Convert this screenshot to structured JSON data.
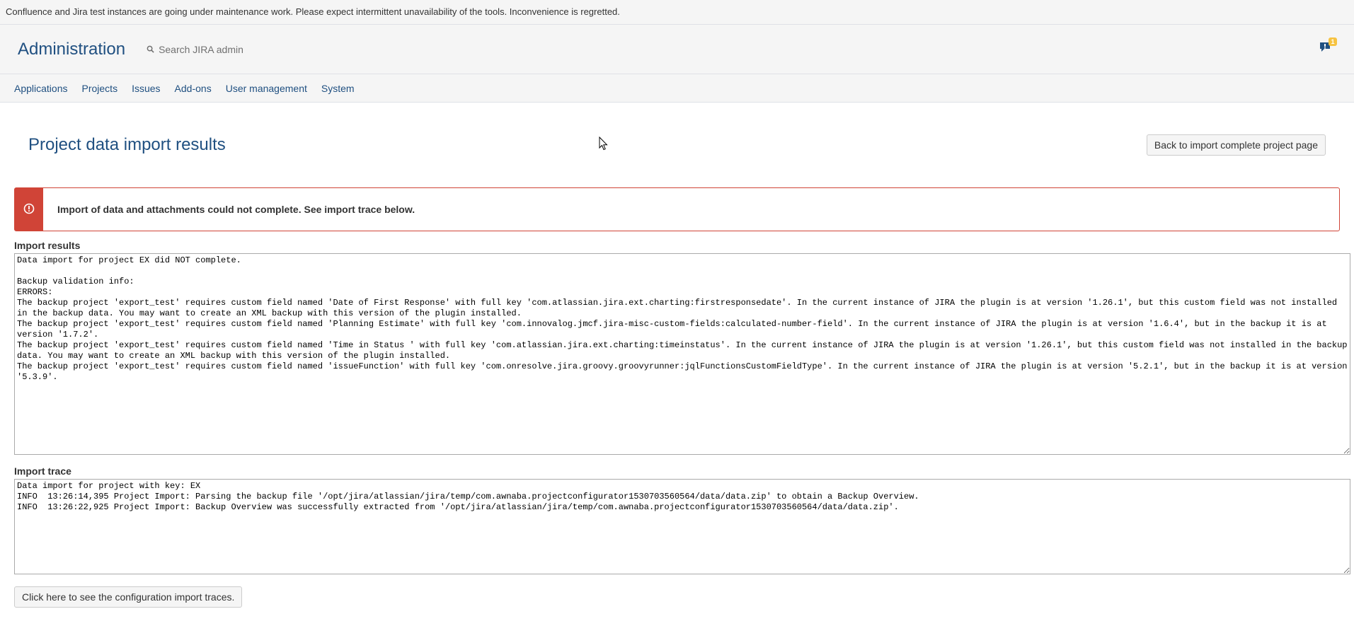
{
  "banner": {
    "text": "Confluence and Jira test instances are going under maintenance work. Please expect intermittent unavailability of the tools. Inconvenience is regretted."
  },
  "header": {
    "title": "Administration",
    "search_placeholder": "Search JIRA admin",
    "notification_count": "1"
  },
  "nav": {
    "items": [
      "Applications",
      "Projects",
      "Issues",
      "Add-ons",
      "User management",
      "System"
    ]
  },
  "page": {
    "title": "Project data import results",
    "back_button": "Back to import complete project page",
    "error_message": "Import of data and attachments could not complete. See import trace below.",
    "results_label": "Import results",
    "results_text": "Data import for project EX did NOT complete.\n\nBackup validation info:\nERRORS:\nThe backup project 'export_test' requires custom field named 'Date of First Response' with full key 'com.atlassian.jira.ext.charting:firstresponsedate'. In the current instance of JIRA the plugin is at version '1.26.1', but this custom field was not installed in the backup data. You may want to create an XML backup with this version of the plugin installed.\nThe backup project 'export_test' requires custom field named 'Planning Estimate' with full key 'com.innovalog.jmcf.jira-misc-custom-fields:calculated-number-field'. In the current instance of JIRA the plugin is at version '1.6.4', but in the backup it is at version '1.7.2'.\nThe backup project 'export_test' requires custom field named 'Time in Status ' with full key 'com.atlassian.jira.ext.charting:timeinstatus'. In the current instance of JIRA the plugin is at version '1.26.1', but this custom field was not installed in the backup data. You may want to create an XML backup with this version of the plugin installed.\nThe backup project 'export_test' requires custom field named 'issueFunction' with full key 'com.onresolve.jira.groovy.groovyrunner:jqlFunctionsCustomFieldType'. In the current instance of JIRA the plugin is at version '5.2.1', but in the backup it is at version '5.3.9'.",
    "trace_label": "Import trace",
    "trace_text": "Data import for project with key: EX\nINFO  13:26:14,395 Project Import: Parsing the backup file '/opt/jira/atlassian/jira/temp/com.awnaba.projectconfigurator1530703560564/data/data.zip' to obtain a Backup Overview.\nINFO  13:26:22,925 Project Import: Backup Overview was successfully extracted from '/opt/jira/atlassian/jira/temp/com.awnaba.projectconfigurator1530703560564/data/data.zip'.",
    "config_button": "Click here to see the configuration import traces."
  },
  "colors": {
    "brand": "#205081",
    "error": "#d04437",
    "badge": "#f6c342"
  },
  "icons": [
    "search-icon",
    "notification-icon",
    "error-icon",
    "cursor-icon"
  ]
}
